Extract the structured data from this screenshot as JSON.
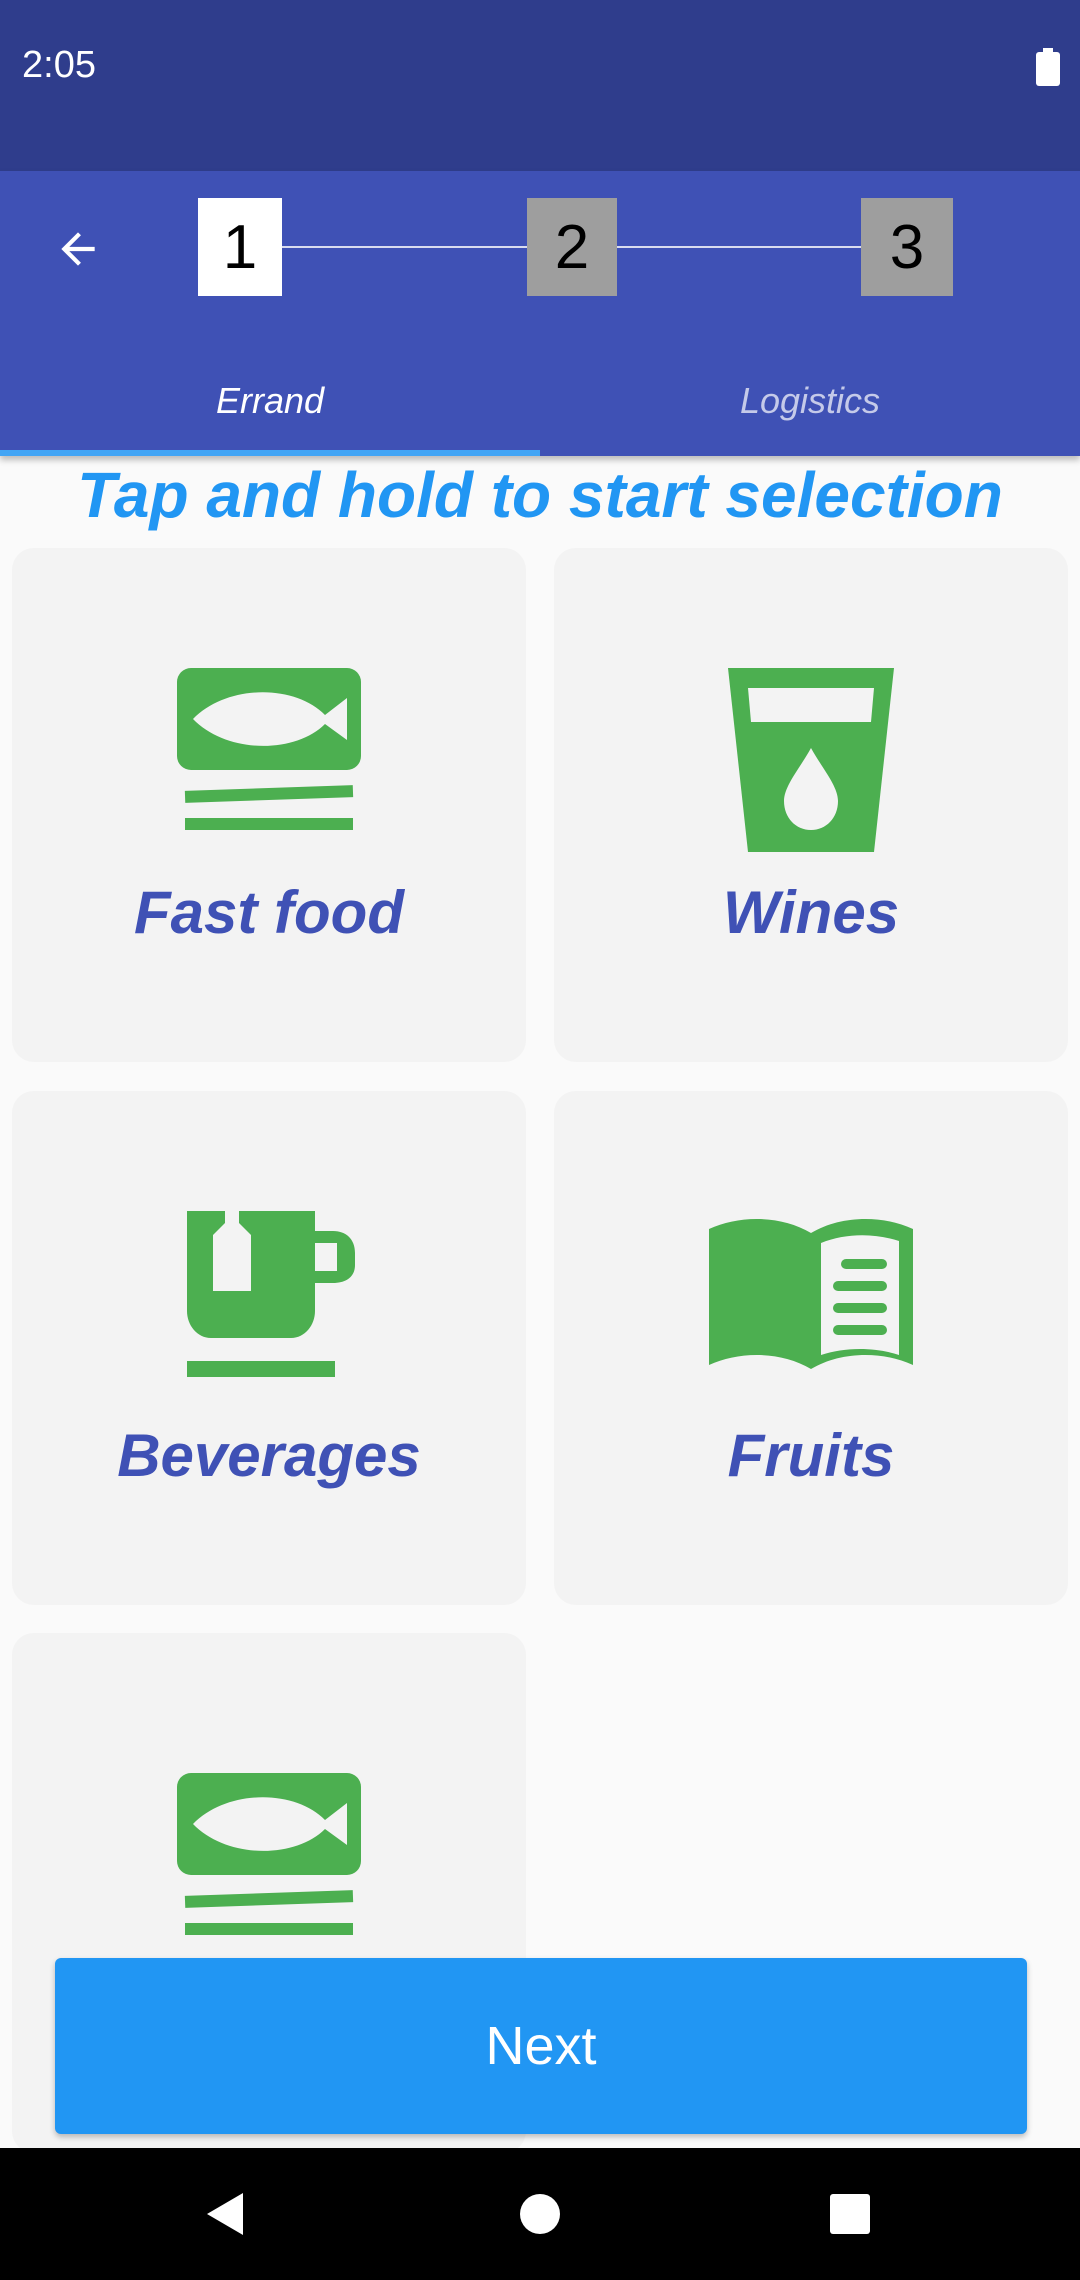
{
  "status_bar": {
    "time": "2:05",
    "battery_icon": "battery-full-icon"
  },
  "app_bar": {
    "back_icon": "arrow-back-icon",
    "steps": [
      {
        "label": "1",
        "active": true
      },
      {
        "label": "2",
        "active": false
      },
      {
        "label": "3",
        "active": false
      }
    ],
    "tabs": [
      {
        "label": "Errand",
        "selected": true
      },
      {
        "label": "Logistics",
        "selected": false
      }
    ]
  },
  "hint": "Tap and hold to start selection",
  "categories": [
    {
      "label": "Fast food",
      "icon": "fish-plate-icon"
    },
    {
      "label": "Wines",
      "icon": "glass-drop-icon"
    },
    {
      "label": "Beverages",
      "icon": "tea-cup-icon"
    },
    {
      "label": "Fruits",
      "icon": "open-book-icon"
    },
    {
      "label": "",
      "icon": "fish-plate-icon"
    }
  ],
  "next_button": "Next",
  "nav_bar": {
    "back": "triangle-back-icon",
    "home": "circle-home-icon",
    "recents": "square-recents-icon"
  },
  "colors": {
    "status_bar": "#2f3d8c",
    "app_bar": "#3f51b5",
    "accent": "#2196f3",
    "icon_green": "#4caf50",
    "label_indigo": "#3f51b5"
  }
}
